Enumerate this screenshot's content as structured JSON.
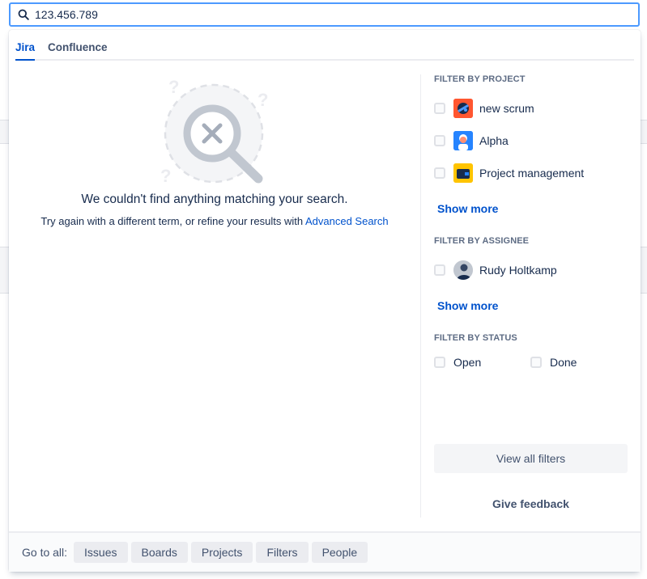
{
  "search": {
    "value": "123.456.789"
  },
  "tabs": [
    {
      "label": "Jira",
      "active": true
    },
    {
      "label": "Confluence",
      "active": false
    }
  ],
  "empty_state": {
    "title": "We couldn't find anything matching your search.",
    "subtitle_prefix": "Try again with a different term, or refine your results with ",
    "link": "Advanced Search"
  },
  "filters": {
    "project": {
      "heading": "FILTER BY PROJECT",
      "items": [
        {
          "label": "new scrum",
          "icon": "project-scrum-icon"
        },
        {
          "label": "Alpha",
          "icon": "project-alpha-icon"
        },
        {
          "label": "Project management",
          "icon": "project-management-icon"
        }
      ],
      "show_more": "Show more"
    },
    "assignee": {
      "heading": "FILTER BY ASSIGNEE",
      "items": [
        {
          "label": "Rudy Holtkamp",
          "icon": "user-avatar"
        }
      ],
      "show_more": "Show more"
    },
    "status": {
      "heading": "FILTER BY STATUS",
      "items": [
        {
          "label": "Open"
        },
        {
          "label": "Done"
        }
      ]
    },
    "view_all": "View all filters",
    "feedback": "Give feedback"
  },
  "footer": {
    "label": "Go to all:",
    "links": [
      "Issues",
      "Boards",
      "Projects",
      "Filters",
      "People"
    ]
  },
  "colors": {
    "accent": "#0052cc",
    "focus_border": "#4c9aff",
    "text": "#172b4d",
    "subtle_text": "#42526e"
  }
}
